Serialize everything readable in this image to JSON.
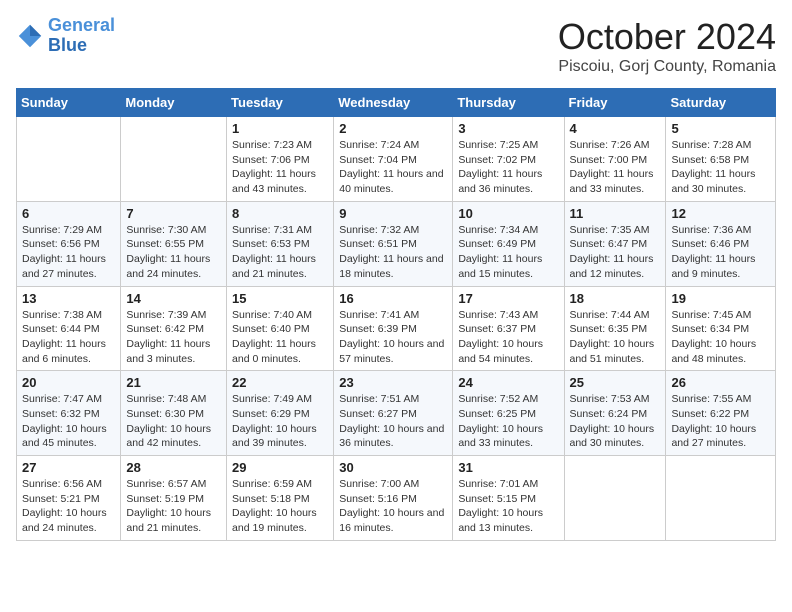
{
  "header": {
    "logo_line1": "General",
    "logo_line2": "Blue",
    "month_title": "October 2024",
    "location": "Piscoiu, Gorj County, Romania"
  },
  "calendar": {
    "days_of_week": [
      "Sunday",
      "Monday",
      "Tuesday",
      "Wednesday",
      "Thursday",
      "Friday",
      "Saturday"
    ],
    "weeks": [
      [
        {
          "day": "",
          "info": ""
        },
        {
          "day": "",
          "info": ""
        },
        {
          "day": "1",
          "info": "Sunrise: 7:23 AM\nSunset: 7:06 PM\nDaylight: 11 hours and 43 minutes."
        },
        {
          "day": "2",
          "info": "Sunrise: 7:24 AM\nSunset: 7:04 PM\nDaylight: 11 hours and 40 minutes."
        },
        {
          "day": "3",
          "info": "Sunrise: 7:25 AM\nSunset: 7:02 PM\nDaylight: 11 hours and 36 minutes."
        },
        {
          "day": "4",
          "info": "Sunrise: 7:26 AM\nSunset: 7:00 PM\nDaylight: 11 hours and 33 minutes."
        },
        {
          "day": "5",
          "info": "Sunrise: 7:28 AM\nSunset: 6:58 PM\nDaylight: 11 hours and 30 minutes."
        }
      ],
      [
        {
          "day": "6",
          "info": "Sunrise: 7:29 AM\nSunset: 6:56 PM\nDaylight: 11 hours and 27 minutes."
        },
        {
          "day": "7",
          "info": "Sunrise: 7:30 AM\nSunset: 6:55 PM\nDaylight: 11 hours and 24 minutes."
        },
        {
          "day": "8",
          "info": "Sunrise: 7:31 AM\nSunset: 6:53 PM\nDaylight: 11 hours and 21 minutes."
        },
        {
          "day": "9",
          "info": "Sunrise: 7:32 AM\nSunset: 6:51 PM\nDaylight: 11 hours and 18 minutes."
        },
        {
          "day": "10",
          "info": "Sunrise: 7:34 AM\nSunset: 6:49 PM\nDaylight: 11 hours and 15 minutes."
        },
        {
          "day": "11",
          "info": "Sunrise: 7:35 AM\nSunset: 6:47 PM\nDaylight: 11 hours and 12 minutes."
        },
        {
          "day": "12",
          "info": "Sunrise: 7:36 AM\nSunset: 6:46 PM\nDaylight: 11 hours and 9 minutes."
        }
      ],
      [
        {
          "day": "13",
          "info": "Sunrise: 7:38 AM\nSunset: 6:44 PM\nDaylight: 11 hours and 6 minutes."
        },
        {
          "day": "14",
          "info": "Sunrise: 7:39 AM\nSunset: 6:42 PM\nDaylight: 11 hours and 3 minutes."
        },
        {
          "day": "15",
          "info": "Sunrise: 7:40 AM\nSunset: 6:40 PM\nDaylight: 11 hours and 0 minutes."
        },
        {
          "day": "16",
          "info": "Sunrise: 7:41 AM\nSunset: 6:39 PM\nDaylight: 10 hours and 57 minutes."
        },
        {
          "day": "17",
          "info": "Sunrise: 7:43 AM\nSunset: 6:37 PM\nDaylight: 10 hours and 54 minutes."
        },
        {
          "day": "18",
          "info": "Sunrise: 7:44 AM\nSunset: 6:35 PM\nDaylight: 10 hours and 51 minutes."
        },
        {
          "day": "19",
          "info": "Sunrise: 7:45 AM\nSunset: 6:34 PM\nDaylight: 10 hours and 48 minutes."
        }
      ],
      [
        {
          "day": "20",
          "info": "Sunrise: 7:47 AM\nSunset: 6:32 PM\nDaylight: 10 hours and 45 minutes."
        },
        {
          "day": "21",
          "info": "Sunrise: 7:48 AM\nSunset: 6:30 PM\nDaylight: 10 hours and 42 minutes."
        },
        {
          "day": "22",
          "info": "Sunrise: 7:49 AM\nSunset: 6:29 PM\nDaylight: 10 hours and 39 minutes."
        },
        {
          "day": "23",
          "info": "Sunrise: 7:51 AM\nSunset: 6:27 PM\nDaylight: 10 hours and 36 minutes."
        },
        {
          "day": "24",
          "info": "Sunrise: 7:52 AM\nSunset: 6:25 PM\nDaylight: 10 hours and 33 minutes."
        },
        {
          "day": "25",
          "info": "Sunrise: 7:53 AM\nSunset: 6:24 PM\nDaylight: 10 hours and 30 minutes."
        },
        {
          "day": "26",
          "info": "Sunrise: 7:55 AM\nSunset: 6:22 PM\nDaylight: 10 hours and 27 minutes."
        }
      ],
      [
        {
          "day": "27",
          "info": "Sunrise: 6:56 AM\nSunset: 5:21 PM\nDaylight: 10 hours and 24 minutes."
        },
        {
          "day": "28",
          "info": "Sunrise: 6:57 AM\nSunset: 5:19 PM\nDaylight: 10 hours and 21 minutes."
        },
        {
          "day": "29",
          "info": "Sunrise: 6:59 AM\nSunset: 5:18 PM\nDaylight: 10 hours and 19 minutes."
        },
        {
          "day": "30",
          "info": "Sunrise: 7:00 AM\nSunset: 5:16 PM\nDaylight: 10 hours and 16 minutes."
        },
        {
          "day": "31",
          "info": "Sunrise: 7:01 AM\nSunset: 5:15 PM\nDaylight: 10 hours and 13 minutes."
        },
        {
          "day": "",
          "info": ""
        },
        {
          "day": "",
          "info": ""
        }
      ]
    ]
  }
}
